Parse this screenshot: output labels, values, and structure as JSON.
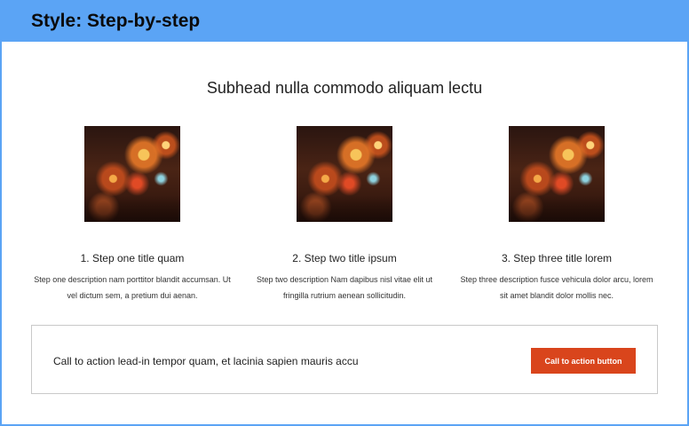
{
  "header": {
    "title": "Style: Step-by-step"
  },
  "subhead": "Subhead nulla commodo aliquam lectu",
  "steps": [
    {
      "title": "1. Step one title quam",
      "description": "Step one description nam porttitor blandit accumsan. Ut vel dictum sem, a pretium dui aenan."
    },
    {
      "title": "2. Step two title ipsum",
      "description": "Step two description Nam dapibus nisl vitae elit ut fringilla rutrium aenean sollicitudin."
    },
    {
      "title": "3. Step three title lorem",
      "description": "Step three description fusce vehicula dolor arcu, lorem sit amet blandit dolor mollis nec."
    }
  ],
  "cta": {
    "lead_in": "Call to action lead-in tempor quam, et lacinia sapien mauris accu",
    "button_label": "Call to action button"
  },
  "colors": {
    "header_bg": "#5ba4f5",
    "cta_button": "#d9451c"
  }
}
